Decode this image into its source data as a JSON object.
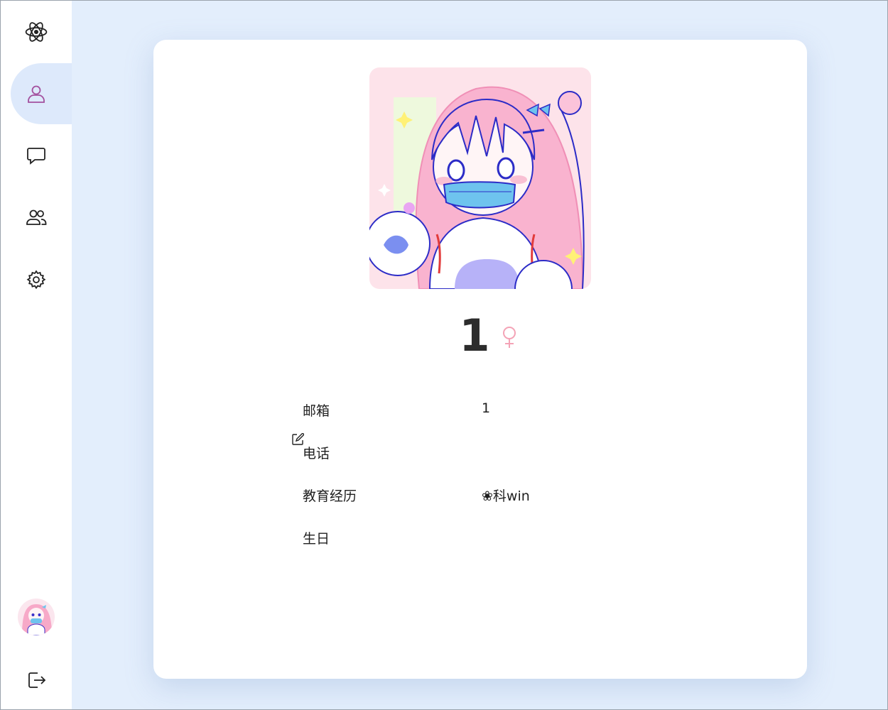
{
  "sidebar": {
    "logo_icon": "atom-icon",
    "items": [
      {
        "name": "profile",
        "icon": "user-icon",
        "active": true
      },
      {
        "name": "chat",
        "icon": "chat-bubble-icon",
        "active": false
      },
      {
        "name": "contacts",
        "icon": "users-icon",
        "active": false
      },
      {
        "name": "settings",
        "icon": "gear-icon",
        "active": false
      }
    ],
    "logout_icon": "logout-icon",
    "accent_color": "#dde9fb",
    "active_icon_color": "#a3509e"
  },
  "profile": {
    "name": "1",
    "gender_symbol": "♀",
    "gender_color": "#f4a3b6",
    "fields": [
      {
        "label": "邮箱",
        "value": "1"
      },
      {
        "label": "电话",
        "value": ""
      },
      {
        "label": "教育经历",
        "value": "❀科win"
      },
      {
        "label": "生日",
        "value": ""
      }
    ],
    "edit_icon": "edit-icon"
  },
  "colors": {
    "background": "#e3eefc",
    "card": "#ffffff"
  }
}
